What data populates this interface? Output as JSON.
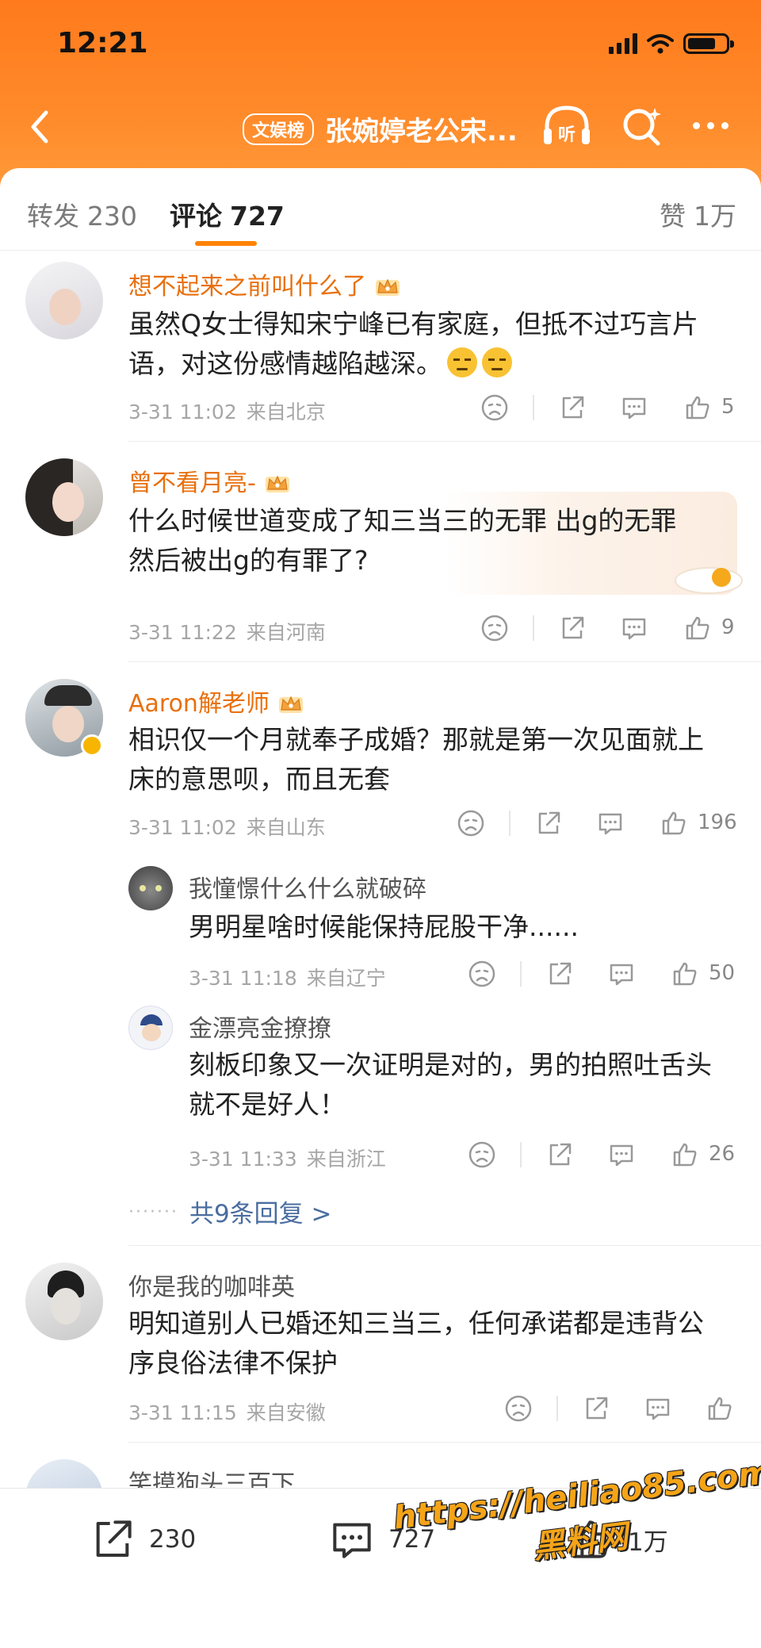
{
  "status_bar": {
    "time": "12:21"
  },
  "nav": {
    "badge": "文娱榜",
    "title": "张婉婷老公宋...",
    "listen_label": "听"
  },
  "tabs": [
    {
      "label": "转发",
      "count": "230"
    },
    {
      "label": "评论",
      "count": "727",
      "active": true
    },
    {
      "label": "赞",
      "count": "1万"
    }
  ],
  "comments": [
    {
      "user": "想不起来之前叫什么了",
      "text_line1": "虽然Q女士得知宋宁峰已有家庭，但抵不过巧言片",
      "text_line2": "语，对这份感情越陷越深。",
      "time": "3-31 11:02",
      "location": "来自北京",
      "likes": "5"
    },
    {
      "user": "曾不看月亮-",
      "text_line1": "什么时候世道变成了知三当三的无罪 出g的无罪",
      "text_line2": "然后被出g的有罪了?",
      "time": "3-31 11:22",
      "location": "来自河南",
      "likes": "9"
    },
    {
      "user": "Aaron解老师",
      "text_line1": "相识仅一个月就奉子成婚？那就是第一次见面就上",
      "text_line2": "床的意思呗，而且无套",
      "time": "3-31 11:02",
      "location": "来自山东",
      "likes": "196",
      "replies": [
        {
          "user": "我憧憬什么什么就破碎",
          "text_line1": "男明星啥时候能保持屁股干净......",
          "time": "3-31 11:18",
          "location": "来自辽宁",
          "likes": "50"
        },
        {
          "user": "金漂亮金撩撩",
          "text_line1": "刻板印象又一次证明是对的，男的拍照吐舌头",
          "text_line2": "就不是好人！",
          "time": "3-31 11:33",
          "location": "来自浙江",
          "likes": "26"
        }
      ],
      "more_replies": "共9条回复 >"
    },
    {
      "user": "你是我的咖啡英",
      "text_line1": "明知道别人已婚还知三当三，任何承诺都是违背公",
      "text_line2": "序良俗法律不保护",
      "time": "3-31 11:15",
      "location": "来自安徽"
    },
    {
      "user": "笑摸狗头三百下"
    }
  ],
  "bottom_bar": {
    "repost": "230",
    "comment": "727",
    "like": "1万"
  },
  "watermark": {
    "line1": "https://heiliao85.com",
    "line2": "黑料网"
  },
  "colors": {
    "brand_orange": "#ff8200",
    "username_orange": "#e8700e",
    "link_blue": "#4a6da0"
  }
}
